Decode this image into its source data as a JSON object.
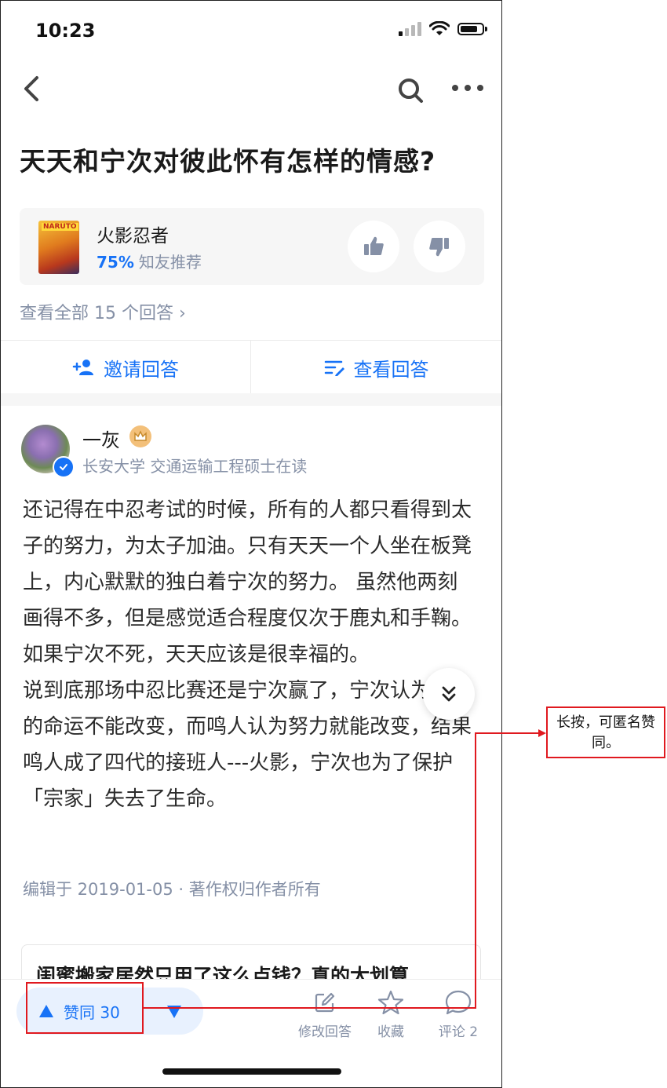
{
  "status_bar": {
    "time": "10:23"
  },
  "question": {
    "title": "天天和宁次对彼此怀有怎样的情感?"
  },
  "topic": {
    "cover_logo": "NARUTO",
    "name": "火影忍者",
    "rate_pct": "75%",
    "rate_label": "知友推荐"
  },
  "view_all_label": "查看全部 15 个回答 ›",
  "actions": {
    "invite": "邀请回答",
    "view": "查看回答"
  },
  "author": {
    "name": "一灰",
    "bio": "长安大学 交通运输工程硕士在读"
  },
  "answer": {
    "paragraphs": [
      "还记得在中忍考试的时候，所有的人都只看得到太子的努力，为太子加油。只有天天一个人坐在板凳上，内心默默的独白着宁次的努力。 虽然他两刻画得不多，但是感觉适合程度仅次于鹿丸和手鞠。如果宁次不死，天天应该是很幸福的。",
      "说到底那场中忍比赛还是宁次赢了，宁次认为人物的命运不能改变，而鸣人认为努力就能改变，结果鸣人成了四代的接班人---火影，宁次也为了保护「宗家」失去了生命。"
    ],
    "meta": "编辑于 2019-01-05 · 著作权归作者所有"
  },
  "ad": {
    "title": "闺蜜搬家居然只用了这么点钱？真的太划算"
  },
  "bottom_bar": {
    "vote_label": "赞同 30",
    "edit_label": "修改回答",
    "collect_label": "收藏",
    "comment_label": "评论 2"
  },
  "annotation": {
    "note": "长按，可匿名赞同。"
  },
  "colors": {
    "accent": "#1772f6",
    "annotation": "#e0191f",
    "muted": "#8590a6"
  },
  "battery_level": 0.8
}
